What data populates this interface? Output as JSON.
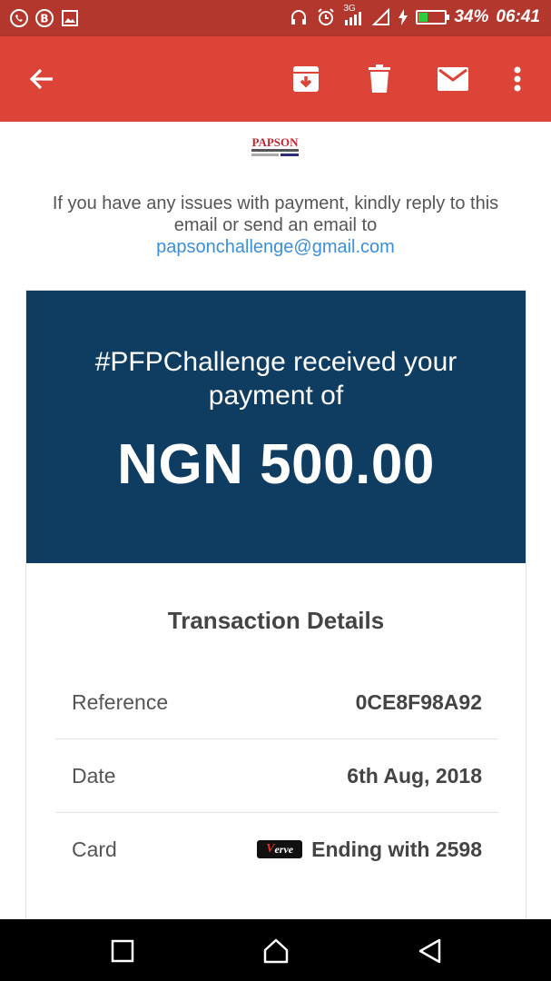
{
  "status_bar": {
    "left_icons": [
      "whatsapp-icon",
      "b-app-icon",
      "gallery-icon"
    ],
    "right_icons": [
      "headphones-icon",
      "alarm-icon",
      "signal-icon",
      "wifi-icon",
      "charging-icon"
    ],
    "network_label": "3G",
    "battery_percent": "34%",
    "battery_level": 0.34,
    "time": "06:41"
  },
  "app_bar": {
    "color": "#db4437",
    "icons": [
      "back-arrow-icon",
      "archive-icon",
      "delete-icon",
      "mark-unread-icon",
      "more-vert-icon"
    ]
  },
  "email": {
    "logo_text": "PAPSON",
    "issue_text": "If you have any issues with payment, kindly reply to this email or send an email to",
    "contact_email": "papsonchallenge@gmail.com",
    "banner": {
      "line": "#PFPChallenge received your payment of",
      "amount": "NGN 500.00",
      "color": "#0f3d62"
    },
    "details": {
      "title": "Transaction Details",
      "rows": [
        {
          "label": "Reference",
          "value": "0CE8F98A92"
        },
        {
          "label": "Date",
          "value": "6th Aug, 2018"
        },
        {
          "label": "Card",
          "value": "Ending with 2598",
          "card_brand": "Verve"
        }
      ]
    }
  },
  "nav_bar": {
    "icons": [
      "recents-icon",
      "home-icon",
      "back-icon"
    ]
  }
}
